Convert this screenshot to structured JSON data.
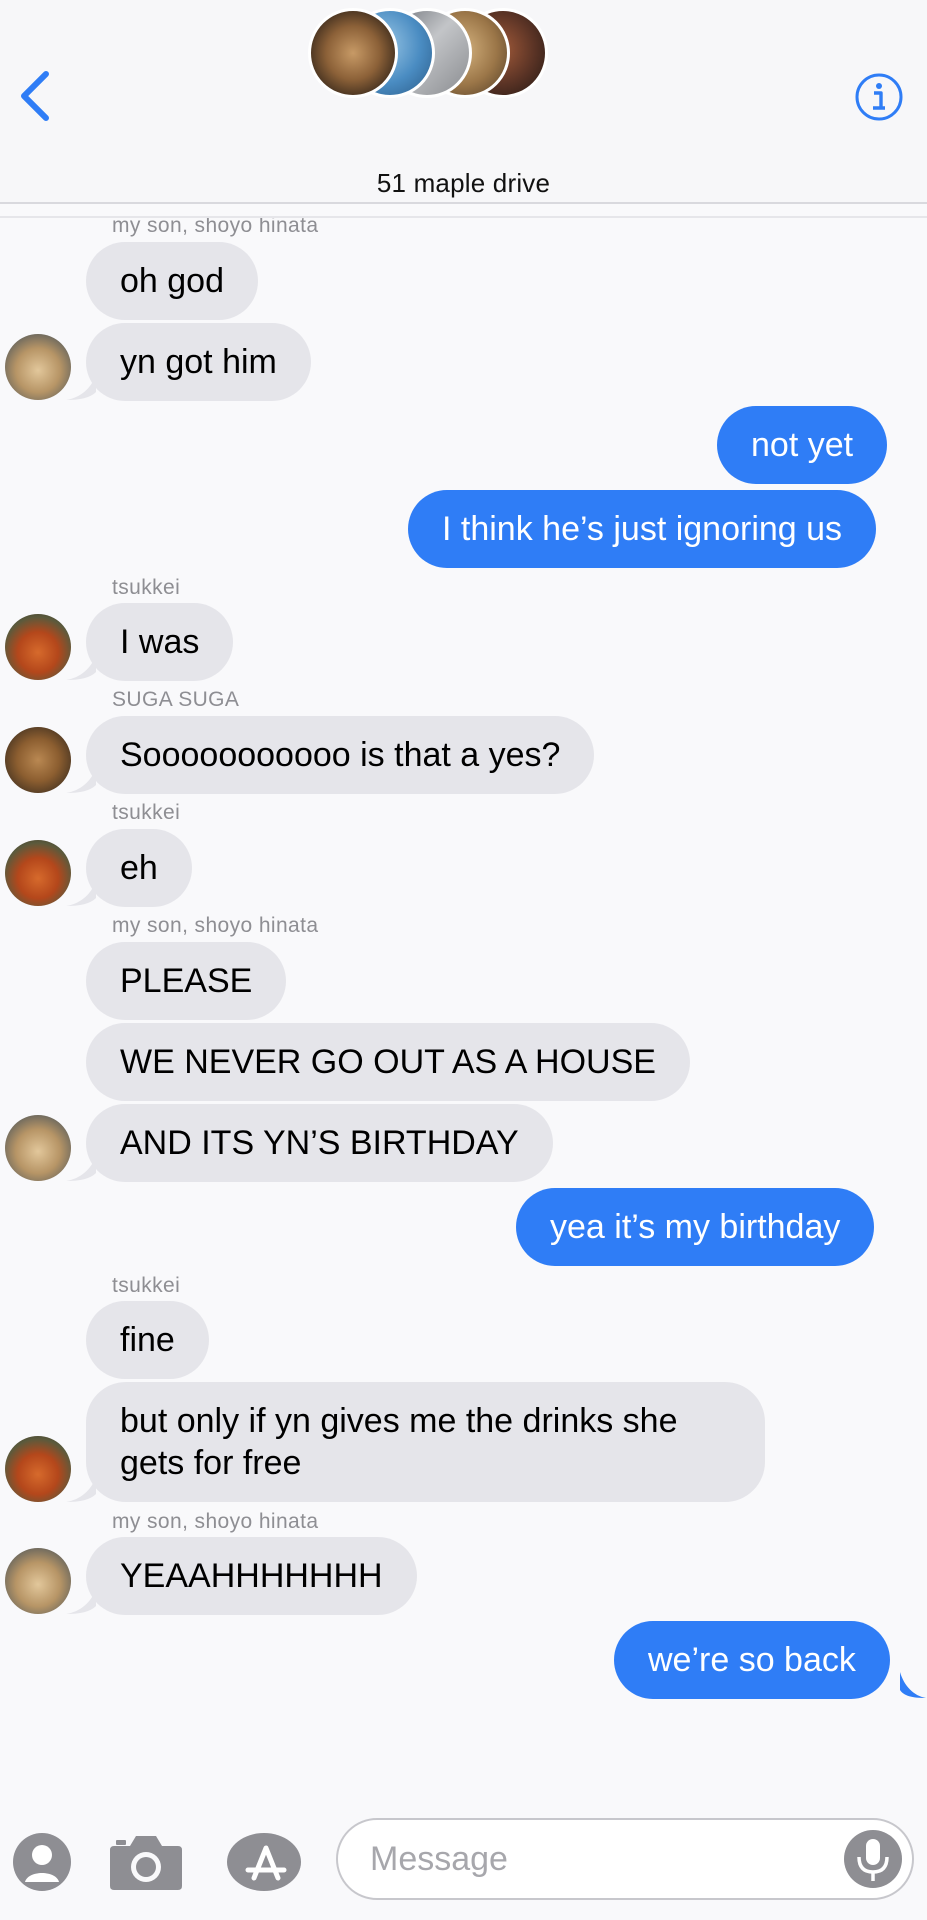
{
  "header": {
    "title": "51 maple drive",
    "back_icon": "chevron-left-icon",
    "info_icon": "info-icon"
  },
  "messages": [
    {
      "sender": "my son, shoyo hinata",
      "text": "oh god"
    },
    {
      "text": "yn got him"
    },
    {
      "text": "not yet"
    },
    {
      "text": "I think he’s just ignoring us"
    },
    {
      "sender": "tsukkei",
      "text": "I was"
    },
    {
      "sender": "SUGA SUGA",
      "text": "Sooooooooooo is that a yes?"
    },
    {
      "sender": "tsukkei",
      "text": "eh"
    },
    {
      "sender": "my son, shoyo hinata",
      "text": "PLEASE"
    },
    {
      "text": "WE NEVER GO OUT AS A HOUSE"
    },
    {
      "text": "AND ITS YN’S BIRTHDAY"
    },
    {
      "text": "yea it’s my birthday"
    },
    {
      "sender": "tsukkei",
      "text": "fine"
    },
    {
      "text": "but only if yn gives me the drinks she gets for free"
    },
    {
      "sender": "my son, shoyo hinata",
      "text": "YEAAHHHHHHH"
    },
    {
      "text": "we’re so back"
    }
  ],
  "composer": {
    "placeholder": "Message",
    "value": "",
    "icons": [
      "contact-icon",
      "camera-icon",
      "app-store-icon",
      "microphone-icon"
    ]
  },
  "colors": {
    "outgoing": "#2f7df6",
    "incoming": "#e5e5ea",
    "accent": "#2f7df6"
  }
}
